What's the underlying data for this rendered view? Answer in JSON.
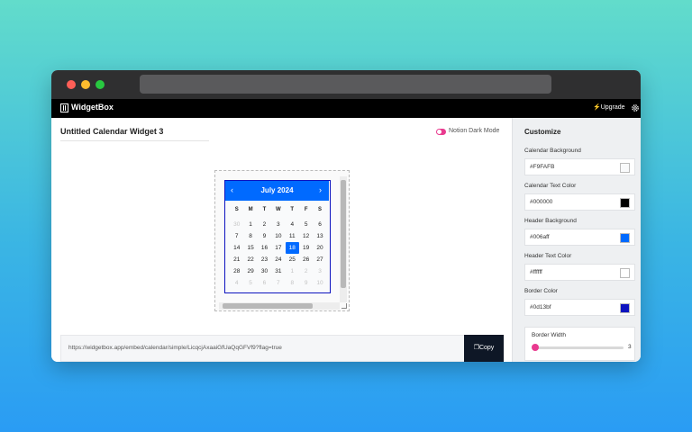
{
  "app": {
    "brand": "WidgetBox",
    "upgrade_label": "⚡Upgrade",
    "logo_icon": "widgetbox-logo-icon",
    "settings_icon": "gear-icon"
  },
  "editor": {
    "widget_title": "Untitled Calendar Widget 3",
    "dark_mode_label": "Notion Dark Mode",
    "dark_mode_on": true
  },
  "calendar": {
    "prev_label": "‹",
    "next_label": "›",
    "month_label": "July 2024",
    "weekdays": [
      "S",
      "M",
      "T",
      "W",
      "T",
      "F",
      "S"
    ],
    "weeks": [
      [
        "30",
        "1",
        "2",
        "3",
        "4",
        "5",
        "6"
      ],
      [
        "7",
        "8",
        "9",
        "10",
        "11",
        "12",
        "13"
      ],
      [
        "14",
        "15",
        "16",
        "17",
        "18",
        "19",
        "20"
      ],
      [
        "21",
        "22",
        "23",
        "24",
        "25",
        "26",
        "27"
      ],
      [
        "28",
        "29",
        "30",
        "31",
        "1",
        "2",
        "3"
      ],
      [
        "4",
        "5",
        "6",
        "7",
        "8",
        "9",
        "10"
      ]
    ],
    "today": "18",
    "colors": {
      "background": "#F9FAFB",
      "text": "#000000",
      "header": "#006aff",
      "header_text": "#ffffff",
      "border": "#0d13bf"
    }
  },
  "embed": {
    "url": "https://widgetbox.app/embed/calendar/simple/LicqcjAxaaiGfUaQqGFVf9?flag=true",
    "copy_label": "Copy"
  },
  "customize": {
    "title": "Customize",
    "fields": [
      {
        "label": "Calendar Background",
        "value": "#F9FAFB",
        "color": "#F9FAFB"
      },
      {
        "label": "Calendar Text Color",
        "value": "#000000",
        "color": "#000000"
      },
      {
        "label": "Header Background",
        "value": "#006aff",
        "color": "#006aff"
      },
      {
        "label": "Header Text Color",
        "value": "#ffffff",
        "color": "#ffffff"
      },
      {
        "label": "Border Color",
        "value": "#0d13bf",
        "color": "#0d13bf"
      }
    ],
    "border_width_label": "Border Width",
    "border_width_value": "3"
  }
}
